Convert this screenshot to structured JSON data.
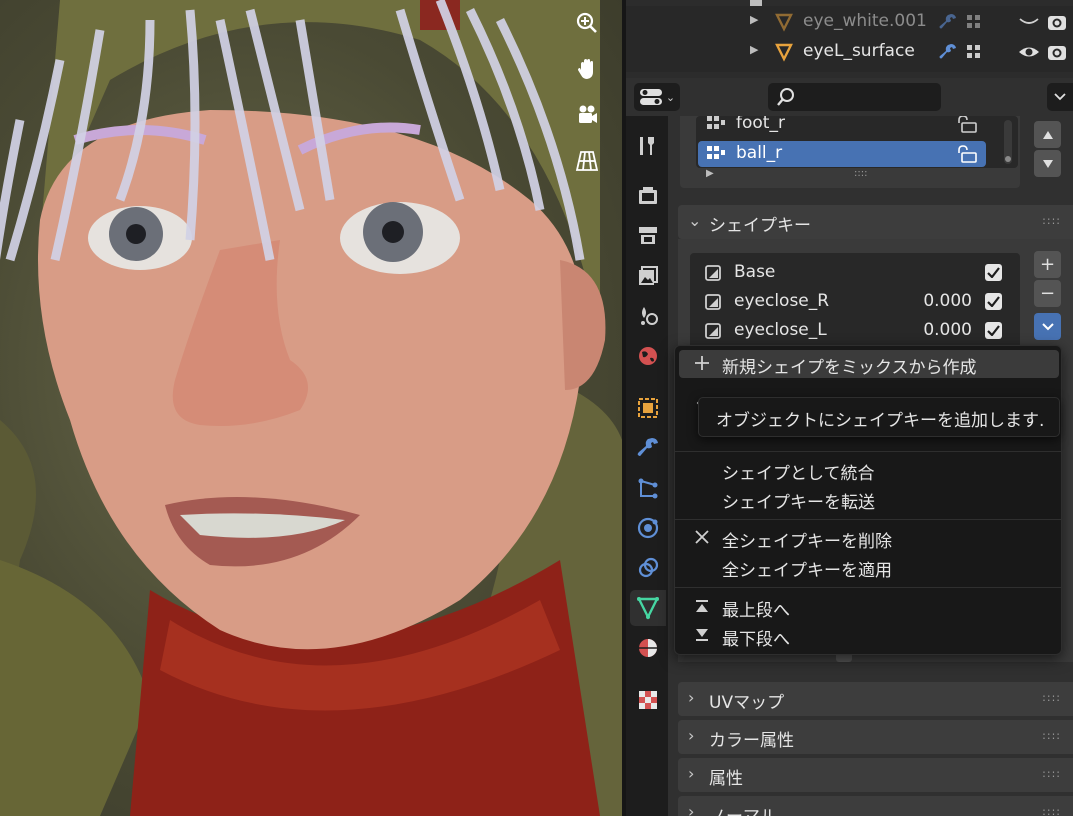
{
  "outliner": {
    "rows": [
      {
        "name": "eye_white.001",
        "dimmed": true
      },
      {
        "name": "eyeL_surface",
        "dimmed": false
      }
    ]
  },
  "bone_groups": {
    "items": [
      {
        "label": "foot_r",
        "selected": false
      },
      {
        "label": "ball_r",
        "selected": true
      }
    ]
  },
  "shape_keys": {
    "title": "シェイプキー",
    "items": [
      {
        "label": "Base",
        "value": "",
        "checked": true
      },
      {
        "label": "eyeclose_R",
        "value": "0.000",
        "checked": true
      },
      {
        "label": "eyeclose_L",
        "value": "0.000",
        "checked": true
      }
    ],
    "add_label": "+",
    "remove_label": "−"
  },
  "menu": {
    "items": [
      {
        "label": "新規シェイプをミックスから作成",
        "icon": "plus-icon"
      },
      {
        "label": "シェイプとして統合",
        "icon": ""
      },
      {
        "label": "シェイプキーを転送",
        "icon": ""
      },
      {
        "label": "全シェイプキーを削除",
        "icon": "x-icon"
      },
      {
        "label": "全シェイプキーを適用",
        "icon": ""
      },
      {
        "label": "最上段へ",
        "icon": "move-top-icon"
      },
      {
        "label": "最下段へ",
        "icon": "move-bottom-icon"
      }
    ]
  },
  "tooltip": {
    "text": "オブジェクトにシェイプキーを追加します."
  },
  "panels": {
    "uv_maps": "UVマップ",
    "color_attributes": "カラー属性",
    "attributes": "属性",
    "normals": "ノーマル"
  },
  "colors": {
    "selection": "#4772b3",
    "mesh_orange": "#e8a33d",
    "active_tab_green": "#46d6a2",
    "tool_blue": "#5f8fd6",
    "panel_bg": "#303030"
  }
}
